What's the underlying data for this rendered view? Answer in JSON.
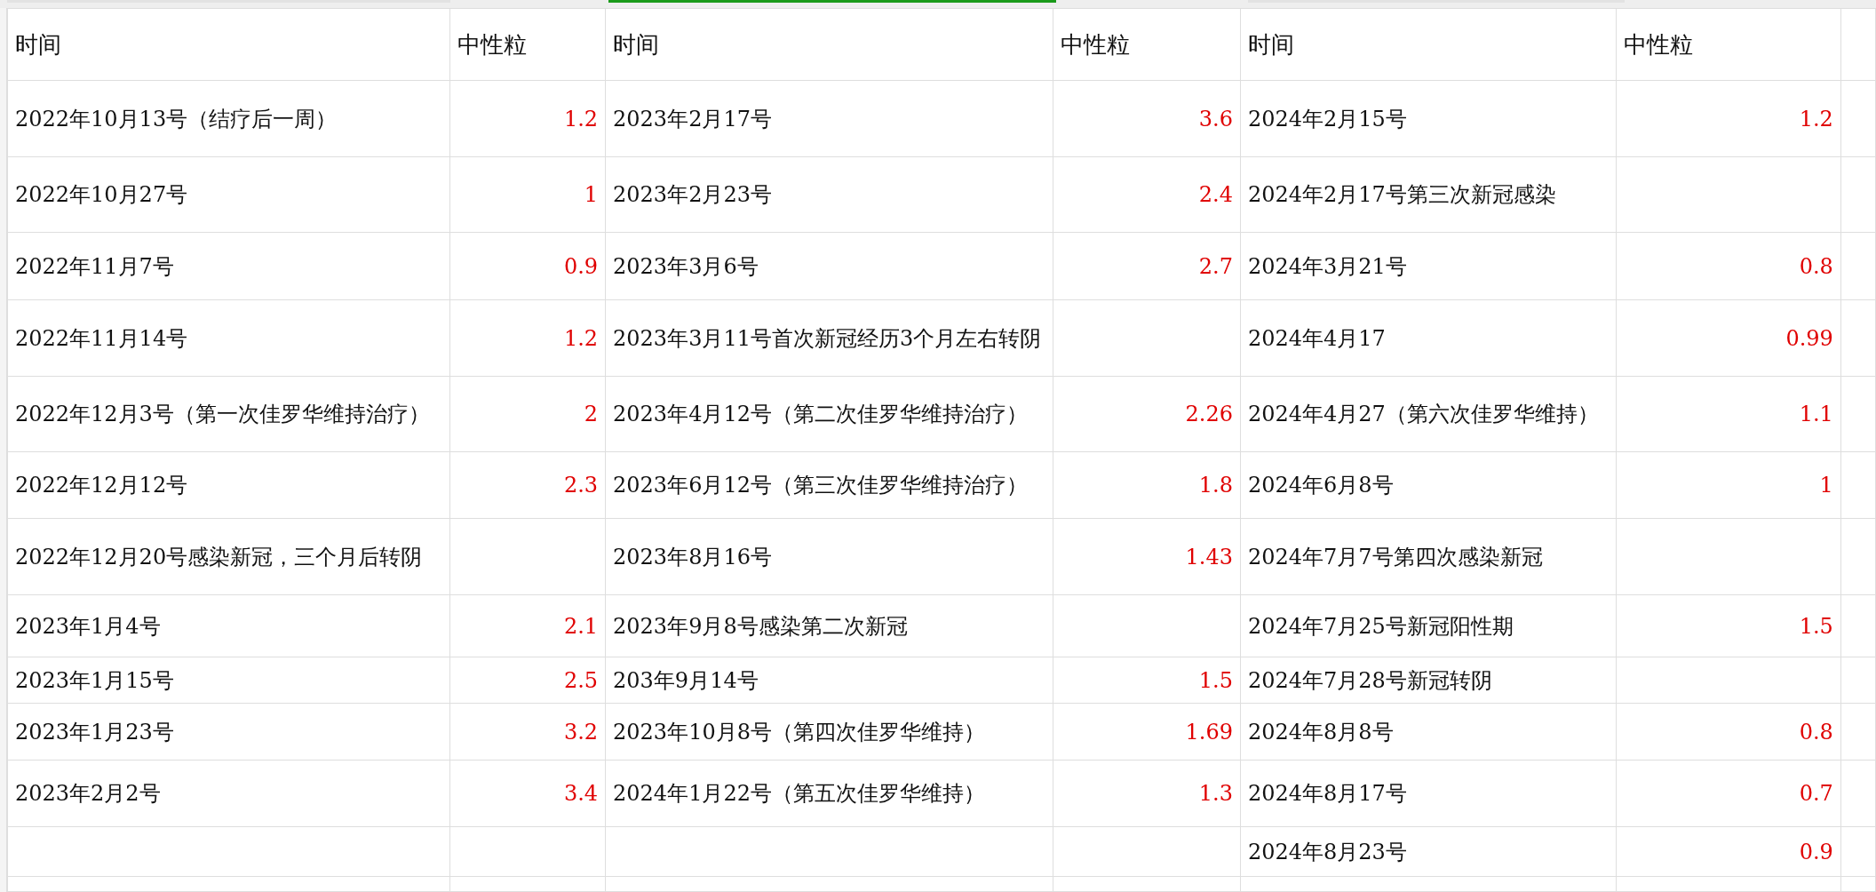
{
  "groups": [
    {
      "selected": false,
      "columns": [
        "时间",
        "中性粒"
      ],
      "rows": [
        {
          "time": "2022年10月13号（结疗后一周）",
          "value": "1.2"
        },
        {
          "time": "2022年10月27号",
          "value": "1"
        },
        {
          "time": "2022年11月7号",
          "value": "0.9"
        },
        {
          "time": "2022年11月14号",
          "value": "1.2"
        },
        {
          "time": "2022年12月3号（第一次佳罗华维持治疗）",
          "value": "2"
        },
        {
          "time": "2022年12月12号",
          "value": "2.3"
        },
        {
          "time": "2022年12月20号感染新冠，三个月后转阴"
        },
        {
          "time": "2023年1月4号",
          "value": "2.1"
        },
        {
          "time": "2023年1月15号",
          "value": "2.5"
        },
        {
          "time": "2023年1月23号",
          "value": "3.2"
        },
        {
          "time": "2023年2月2号",
          "value": "3.4"
        }
      ]
    },
    {
      "selected": true,
      "columns": [
        "时间",
        "中性粒"
      ],
      "rows": [
        {
          "time": "2023年2月17号",
          "value": "3.6"
        },
        {
          "time": "2023年2月23号",
          "value": "2.4"
        },
        {
          "time": "2023年3月6号",
          "value": "2.7"
        },
        {
          "time": "2023年3月11号首次新冠经历3个月左右转阴"
        },
        {
          "time": "2023年4月12号（第二次佳罗华维持治疗）",
          "value": "2.26"
        },
        {
          "time": "2023年6月12号（第三次佳罗华维持治疗）",
          "value": "1.8"
        },
        {
          "time": "2023年8月16号",
          "value": "1.43"
        },
        {
          "time": "2023年9月8号感染第二次新冠"
        },
        {
          "time": "203年9月14号",
          "value": "1.5"
        },
        {
          "time": "2023年10月8号（第四次佳罗华维持）",
          "value": "1.69"
        },
        {
          "time": "2024年1月22号（第五次佳罗华维持）",
          "value": "1.3"
        }
      ]
    },
    {
      "selected": false,
      "columns": [
        "时间",
        "中性粒"
      ],
      "rows": [
        {
          "time": "2024年2月15号",
          "value": "1.2"
        },
        {
          "time": "2024年2月17号第三次新冠感染"
        },
        {
          "time": "2024年3月21号",
          "value": "0.8"
        },
        {
          "time": "2024年4月17",
          "value": "0.99"
        },
        {
          "time": "2024年4月27（第六次佳罗华维持）",
          "value": "1.1"
        },
        {
          "time": "2024年6月8号",
          "value": "1"
        },
        {
          "time": "2024年7月7号第四次感染新冠"
        },
        {
          "time": "2024年7月25号新冠阳性期",
          "value": "1.5"
        },
        {
          "time": "2024年7月28号新冠转阴"
        },
        {
          "time": "2024年8月8号",
          "value": "0.8"
        },
        {
          "time": "2024年8月17号",
          "value": "0.7"
        },
        {
          "time": "2024年8月23号",
          "value": "0.9"
        }
      ]
    }
  ]
}
